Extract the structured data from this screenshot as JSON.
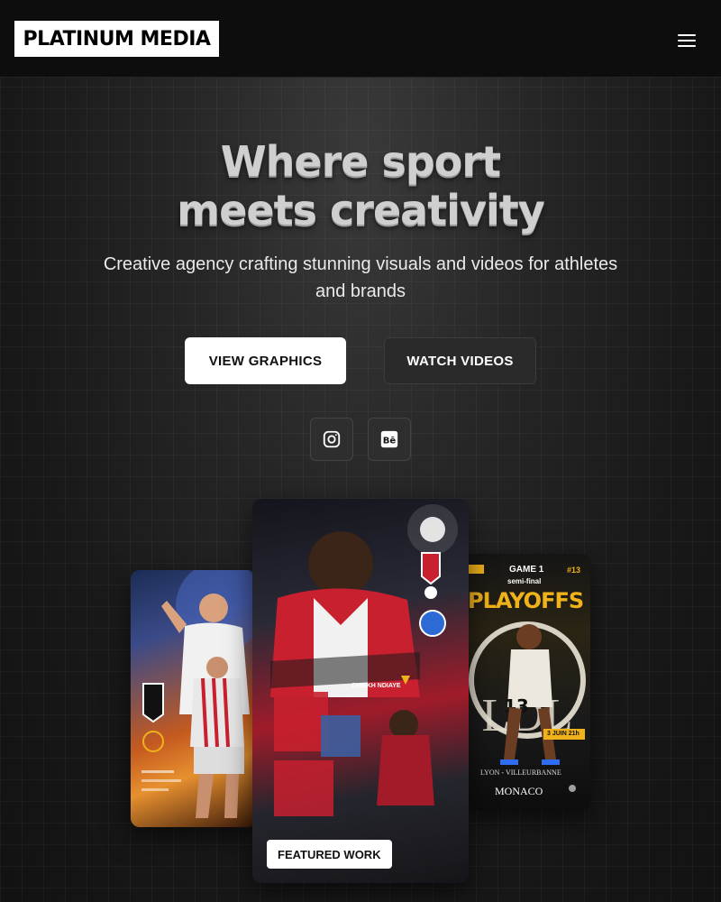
{
  "header": {
    "logo_text": "PLATINUM MEDIA",
    "menu_icon": "hamburger-menu-icon"
  },
  "hero": {
    "title_line1": "Where sport",
    "title_line2": "meets creativity",
    "subtitle": "Creative agency crafting stunning visuals and videos for athletes and brands"
  },
  "buttons": {
    "view_graphics": "VIEW GRAPHICS",
    "watch_videos": "WATCH VIDEOS"
  },
  "social": {
    "instagram_icon": "instagram-icon",
    "behance_icon": "behance-icon"
  },
  "showcase": {
    "featured_badge": "FEATURED WORK",
    "center_caption": "CHEIKH NDIAYE",
    "right_card": {
      "game": "GAME 1",
      "round": "semi-final",
      "headline": "PLAYOFFS",
      "number": "#13",
      "date": "3 JUIN 21h",
      "city": "LYON - VILLEURBANNE",
      "opponent": "MONACO"
    }
  },
  "colors": {
    "background": "#141414",
    "header_bg": "#0d0d0d",
    "accent_yellow": "#f0b21a",
    "accent_red": "#c8202f"
  }
}
